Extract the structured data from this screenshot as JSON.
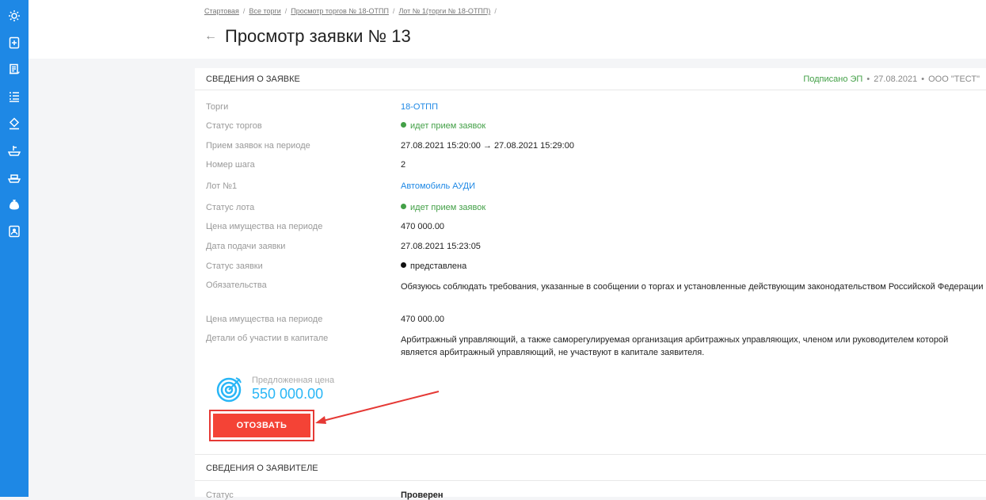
{
  "sidebar": {
    "icons": [
      "gear-icon",
      "document-add-icon",
      "scroll-icon",
      "list-icon",
      "gavel-icon",
      "ship-icon",
      "ship-alt-icon",
      "money-bag-icon",
      "contact-card-icon"
    ]
  },
  "breadcrumb": {
    "items": [
      "Стартовая",
      "Все торги",
      "Просмотр торгов № 18-ОТПП",
      "Лот № 1(торги № 18-ОТПП)"
    ],
    "separator": "/"
  },
  "page": {
    "back": "←",
    "title": "Просмотр заявки № 13"
  },
  "application": {
    "section_title": "СВЕДЕНИЯ О ЗАЯВКЕ",
    "signed_label": "Подписано ЭП",
    "signed_date": "27.08.2021",
    "signed_org": "ООО \"ТЕСТ\"",
    "signed_dot": "•",
    "rows": [
      {
        "label": "Торги",
        "value": "18-ОТПП"
      },
      {
        "label": "Статус торгов",
        "value": "идет прием заявок"
      },
      {
        "label": "Прием заявок на периоде",
        "value": "27.08.2021 15:20:00 → 27.08.2021 15:29:00"
      },
      {
        "label": "Номер шага",
        "value": "2"
      },
      {
        "label": "Лот №1",
        "value": "Автомобиль АУДИ"
      },
      {
        "label": "Статус лота",
        "value": "идет прием заявок"
      },
      {
        "label": "Цена имущества на периоде",
        "value": "470 000.00"
      },
      {
        "label": "Дата подачи заявки",
        "value": "27.08.2021 15:23:05"
      },
      {
        "label": "Статус заявки",
        "value": "представлена"
      },
      {
        "label": "Обязательства",
        "value": "Обязуюсь соблюдать требования, указанные в сообщении о торгах и установленные действующим законодательством Российской Федерации"
      },
      {
        "label": "Цена имущества на периоде",
        "value": "470 000.00"
      },
      {
        "label": "Детали об участии в капитале",
        "value": "Арбитражный управляющий, а также саморегулируемая организация арбитражных управляющих, членом или руководителем которой является арбитражный управляющий, не участвуют в капитале заявителя."
      }
    ],
    "offered_price_label": "Предложенная цена",
    "offered_price": "550 000.00",
    "revoke_button": "ОТОЗВАТЬ"
  },
  "applicant": {
    "section_title": "СВЕДЕНИЯ О ЗАЯВИТЕЛЕ",
    "status_label": "Статус",
    "status_value": "Проверен"
  },
  "colors": {
    "sidebar": "#1e88e5",
    "link": "#1e88e5",
    "status_green": "#43a047",
    "button_red": "#f44336",
    "price_blue": "#29b6f6"
  }
}
